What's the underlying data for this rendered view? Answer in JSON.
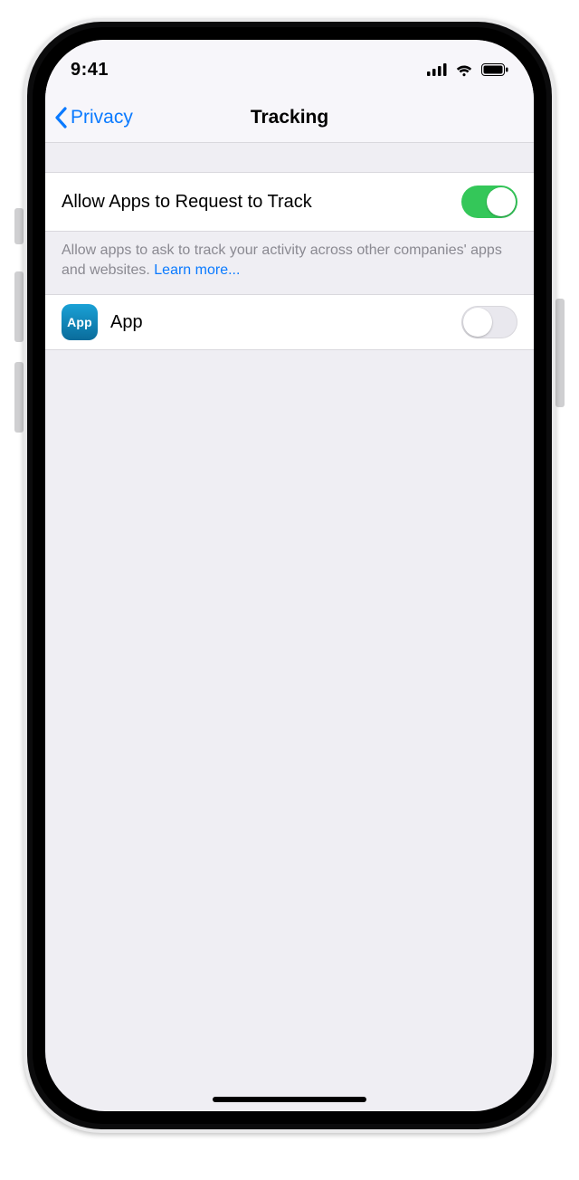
{
  "statusbar": {
    "time": "9:41"
  },
  "nav": {
    "back_label": "Privacy",
    "title": "Tracking"
  },
  "master_toggle": {
    "label": "Allow Apps to Request to Track",
    "on": true
  },
  "footer": {
    "text": "Allow apps to ask to track your activity across other companies' apps and websites. ",
    "link_label": "Learn more..."
  },
  "apps": [
    {
      "name": "App",
      "icon_text": "App",
      "on": false
    }
  ]
}
